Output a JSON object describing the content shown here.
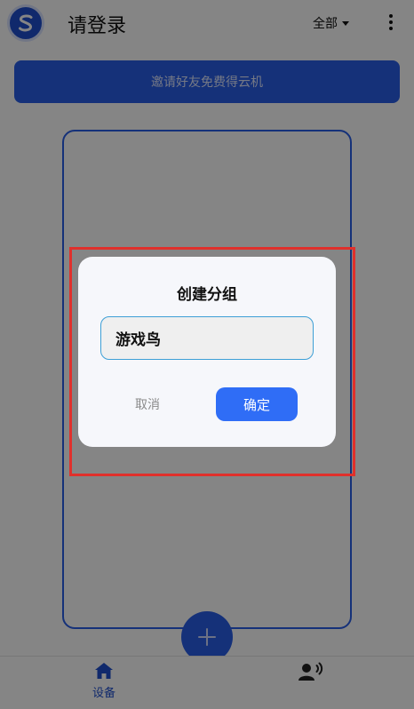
{
  "header": {
    "title": "请登录",
    "filter_label": "全部"
  },
  "banner": {
    "text": "邀请好友免费得云机"
  },
  "dialog": {
    "title": "创建分组",
    "input_value": "游戏鸟",
    "cancel_label": "取消",
    "confirm_label": "确定"
  },
  "bottom_nav": {
    "devices_label": "设备"
  },
  "colors": {
    "brand_blue": "#2a5fe8",
    "confirm_blue": "#2f6df6",
    "input_focus_border": "#3d9fd6",
    "highlight_red": "#e0302c"
  },
  "icons": {
    "logo": "s-logo-icon",
    "filter": "caret-down-icon",
    "menu": "more-vertical-icon",
    "add": "plus-icon",
    "devices_tab": "home-icon",
    "voice_tab": "voice-user-icon"
  }
}
